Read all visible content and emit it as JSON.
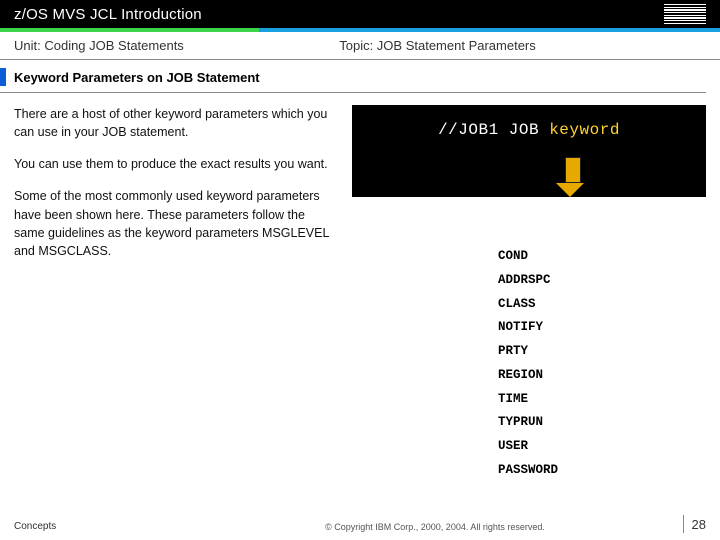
{
  "header": {
    "title": "z/OS MVS JCL Introduction"
  },
  "subheader": {
    "unit": "Unit: Coding JOB Statements",
    "topic": "Topic: JOB Statement Parameters"
  },
  "section": {
    "title": "Keyword Parameters on JOB Statement"
  },
  "body": {
    "p1": "There are a host of other keyword parameters which you can use in your JOB statement.",
    "p2": "You can use them to produce the exact results you want.",
    "p3": "Some of the most commonly used keyword parameters have been shown here. These parameters follow the same guidelines as the keyword parameters MSGLEVEL and MSGCLASS."
  },
  "terminal": {
    "prefix": "//JOB1 JOB ",
    "keyword": "keyword"
  },
  "keywords": [
    "COND",
    "ADDRSPC",
    "CLASS",
    "NOTIFY",
    "PRTY",
    "REGION",
    "TIME",
    "TYPRUN",
    "USER",
    "PASSWORD"
  ],
  "footer": {
    "left": "Concepts",
    "center": "© Copyright IBM Corp., 2000, 2004. All rights reserved.",
    "page": "28"
  }
}
